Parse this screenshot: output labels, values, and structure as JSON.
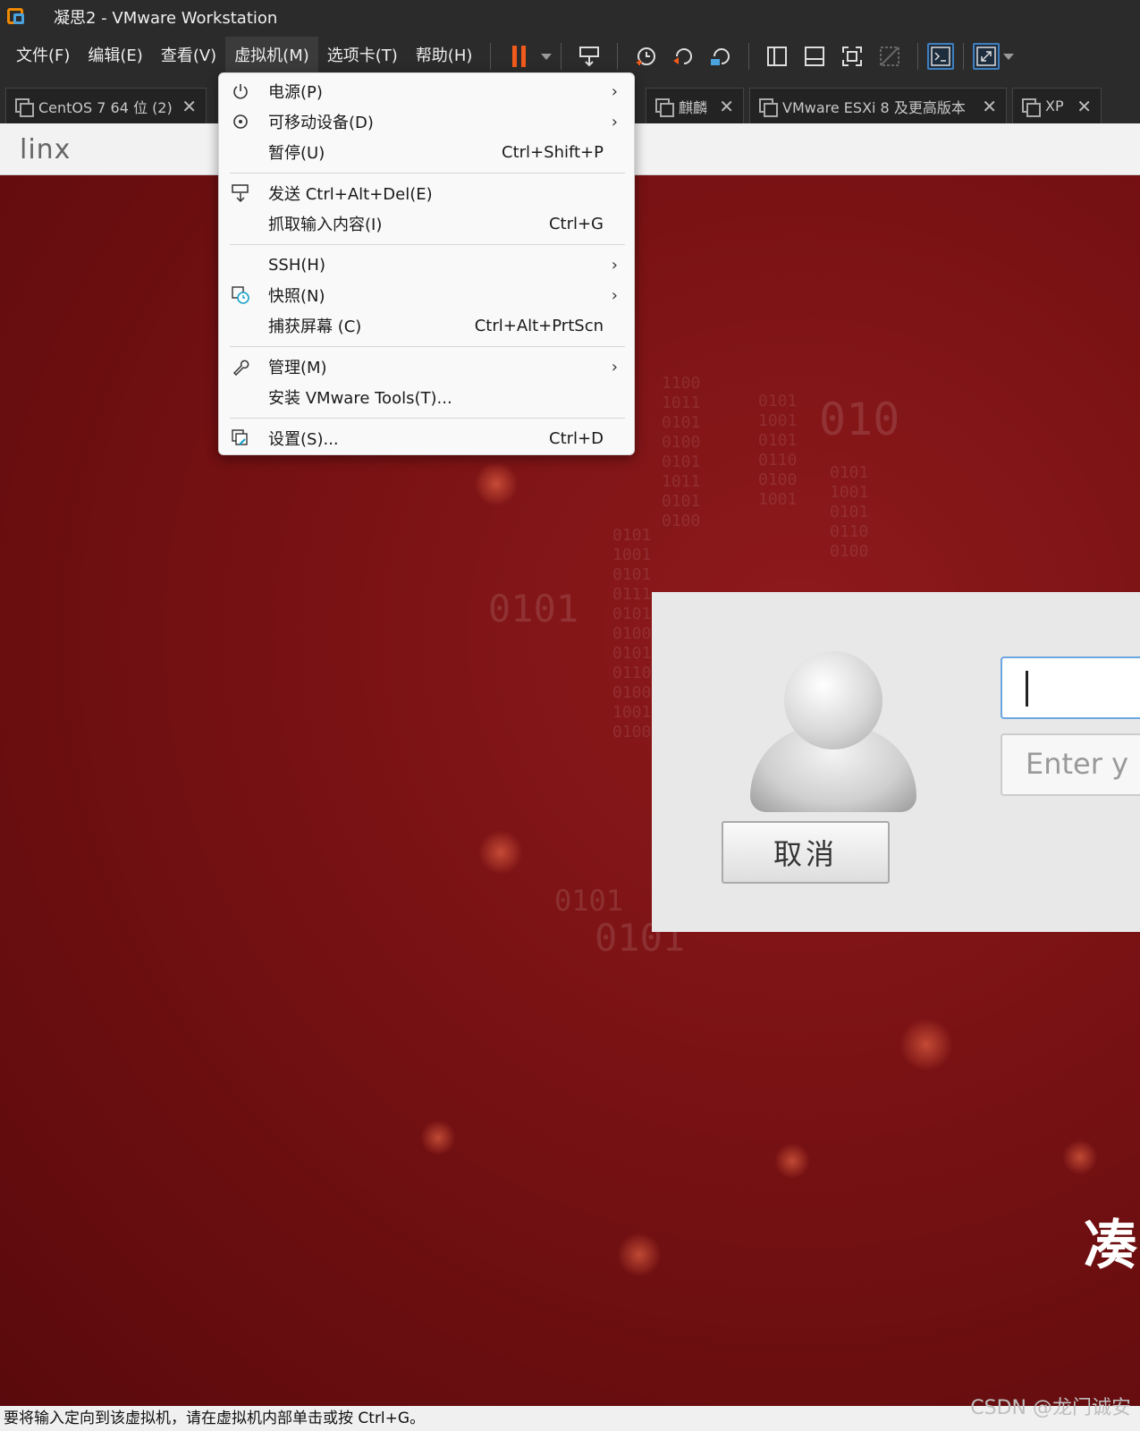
{
  "window": {
    "title": "凝思2 - VMware Workstation"
  },
  "menu": [
    {
      "label": "文件(F)"
    },
    {
      "label": "编辑(E)"
    },
    {
      "label": "查看(V)"
    },
    {
      "label": "虚拟机(M)"
    },
    {
      "label": "选项卡(T)"
    },
    {
      "label": "帮助(H)"
    }
  ],
  "toolbar": {
    "icons": [
      "pause-icon",
      "send-ctrl-alt-del-icon",
      "snapshot-icon",
      "revert-snapshot-icon",
      "snapshot-manager-icon",
      "show-library-icon",
      "thumbnail-bar-icon",
      "full-screen-icon",
      "unity-icon",
      "console-view-icon",
      "stretch-guest-icon"
    ],
    "accent": "#f05a1a"
  },
  "tabs": [
    {
      "label": "CentOS 7 64 位 (2)"
    },
    {
      "label": "麒麟"
    },
    {
      "label": "VMware ESXi 8 及更高版本"
    },
    {
      "label": "XP"
    }
  ],
  "vm": {
    "logo": "linx",
    "binary_text": [
      "0101",
      "0101",
      "010",
      "0101"
    ],
    "login": {
      "cancel_label": "取消",
      "password_placeholder": "Enter y",
      "partial_text": "凑"
    },
    "background_color": "#7a1214"
  },
  "dropdown": {
    "items": [
      {
        "label": "电源(P)",
        "shortcut": "",
        "submenu": true,
        "icon": "power-icon"
      },
      {
        "label": "可移动设备(D)",
        "shortcut": "",
        "submenu": true,
        "icon": "removable-devices-icon"
      },
      {
        "label": "暂停(U)",
        "shortcut": "Ctrl+Shift+P",
        "submenu": false,
        "icon": ""
      },
      {
        "label": "发送 Ctrl+Alt+Del(E)",
        "shortcut": "",
        "submenu": false,
        "icon": "send-keys-icon"
      },
      {
        "label": "抓取输入内容(I)",
        "shortcut": "Ctrl+G",
        "submenu": false,
        "icon": ""
      },
      {
        "label": "SSH(H)",
        "shortcut": "",
        "submenu": true,
        "icon": ""
      },
      {
        "label": "快照(N)",
        "shortcut": "",
        "submenu": true,
        "icon": "snapshot-icon"
      },
      {
        "label": "捕获屏幕 (C)",
        "shortcut": "Ctrl+Alt+PrtScn",
        "submenu": false,
        "icon": ""
      },
      {
        "label": "管理(M)",
        "shortcut": "",
        "submenu": true,
        "icon": "wrench-icon"
      },
      {
        "label": "安装 VMware Tools(T)...",
        "shortcut": "",
        "submenu": false,
        "icon": ""
      },
      {
        "label": "设置(S)...",
        "shortcut": "Ctrl+D",
        "submenu": false,
        "icon": "settings-icon"
      }
    ]
  },
  "statusbar": {
    "text": "要将输入定向到该虚拟机，请在虚拟机内部单击或按 Ctrl+G。"
  },
  "watermark": "CSDN @龙门诚安"
}
